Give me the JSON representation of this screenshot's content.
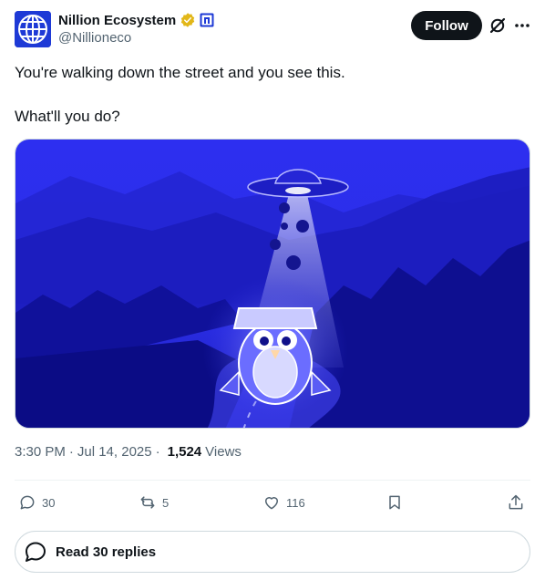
{
  "account": {
    "display_name": "Nillion Ecosystem",
    "handle": "@Nillioneco",
    "avatar_icon": "globe-logo-icon",
    "verified_icon": "verified-badge-icon",
    "affiliate_icon": "affiliate-badge-icon"
  },
  "header": {
    "follow_label": "Follow",
    "grok_icon": "grok-icon",
    "more_icon": "more-icon"
  },
  "post": {
    "line1": "You're walking down the street and you see this.",
    "line2": "What'll you do?"
  },
  "meta": {
    "time": "3:30 PM",
    "date": "Jul 14, 2025",
    "views": "1,524",
    "views_label": "Views"
  },
  "actions": {
    "replies": "30",
    "reposts": "5",
    "likes": "116"
  },
  "read_replies": {
    "label": "Read 30 replies"
  },
  "colors": {
    "accent": "#0f1419",
    "muted": "#536471",
    "media_blue": "#2a2ae8",
    "avatar_blue": "#1e3ad6",
    "verified_gold": "#e2b719"
  }
}
